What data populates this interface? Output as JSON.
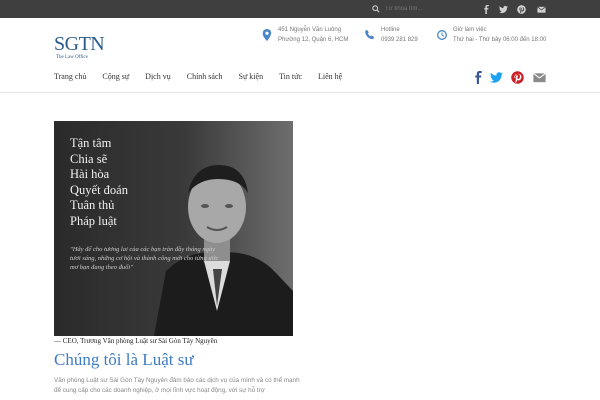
{
  "topbar": {
    "search_placeholder": "Từ khóa tìm...",
    "socials": [
      "facebook-icon",
      "twitter-icon",
      "pinterest-icon",
      "mail-icon"
    ]
  },
  "logo": {
    "mark": "SGTN",
    "tagline": "The Law Office"
  },
  "header": {
    "address": {
      "line1": "451 Nguyễn Văn Luông",
      "line2": "Phường 12, Quận 6, HCM"
    },
    "hotline": {
      "line1": "Hotline",
      "line2": "0939 281 829"
    },
    "hours": {
      "line1": "Giờ làm việc",
      "line2": "Thứ hai - Thứ bảy 06:00 đến 18:00"
    }
  },
  "nav": {
    "items": [
      "Trang chủ",
      "Cộng sự",
      "Dịch vụ",
      "Chính sách",
      "Sự kiện",
      "Tin tức",
      "Liên hệ"
    ]
  },
  "hero": {
    "words": [
      "Tận tâm",
      "Chia sẽ",
      "Hài hòa",
      "Quyết đoán",
      "Tuân thủ",
      "Pháp luật"
    ],
    "quote": "\"Hãy để cho tương lai của các bạn tràn đầy tháng ngày tươi sáng, những cơ hội và thành công mới cho từng ước mơ bạn đang theo đuổi\""
  },
  "caption": "— CEO, Trương Văn phòng Luật sư Sài Gòn Tây Nguyên",
  "headline": "Chúng tôi là Luật sư",
  "paragraph": "Văn phòng Luật sư Sài Gòn Tây Nguyên đảm bảo các dịch vụ của mình và có thể mạnh để cung cấp cho các doanh nghiệp, ở mọi lĩnh vực hoạt động, với sự hỗ trợ",
  "colors": {
    "accent": "#3e7cc4",
    "topbar": "#3f3f3f",
    "facebook": "#3b5998",
    "twitter": "#1da1f2",
    "pinterest": "#cb2027"
  }
}
